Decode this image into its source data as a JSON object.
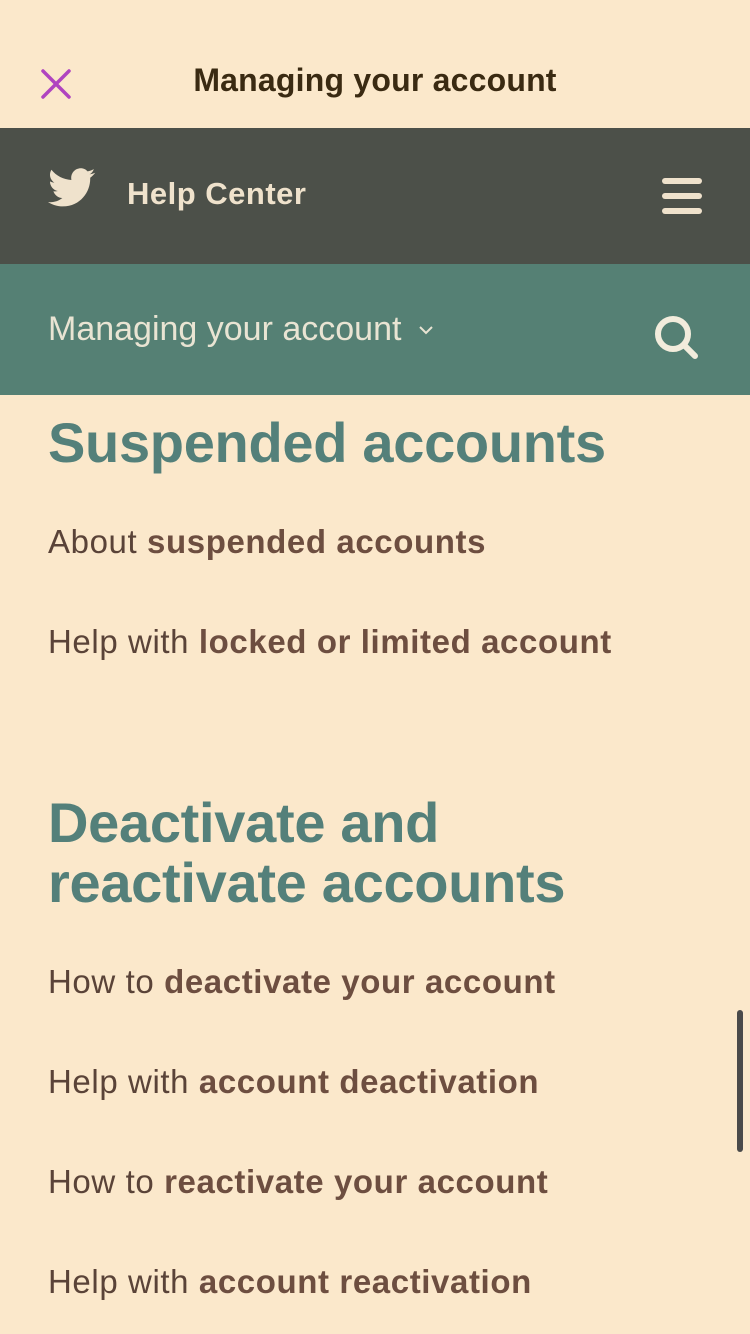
{
  "top_bar": {
    "title": "Managing your account",
    "close_color": "#b044c0"
  },
  "header": {
    "brand": "Help Center",
    "logo_icon": "twitter-bird-icon",
    "menu_icon": "hamburger-menu-icon"
  },
  "subnav": {
    "section": "Managing your account",
    "dropdown_icon": "chevron-down-icon",
    "search_icon": "search-icon"
  },
  "sections": [
    {
      "heading": "Suspended accounts",
      "links": [
        {
          "prefix": "About",
          "bold": "suspended accounts"
        },
        {
          "prefix": "Help with",
          "bold": "locked or limited account"
        }
      ]
    },
    {
      "heading_line1": "Deactivate and",
      "heading_line2": "reactivate accounts",
      "links": [
        {
          "prefix": "How to",
          "bold": "deactivate your account"
        },
        {
          "prefix": "Help with",
          "bold": "account deactivation"
        },
        {
          "prefix": "How to",
          "bold": "reactivate your account"
        },
        {
          "prefix": "Help with",
          "bold": "account reactivation"
        }
      ]
    }
  ],
  "colors": {
    "background": "#fbe8cb",
    "header": "#4c5049",
    "subnav": "#558074",
    "heading": "#54807a",
    "link_text": "#5a4338"
  }
}
